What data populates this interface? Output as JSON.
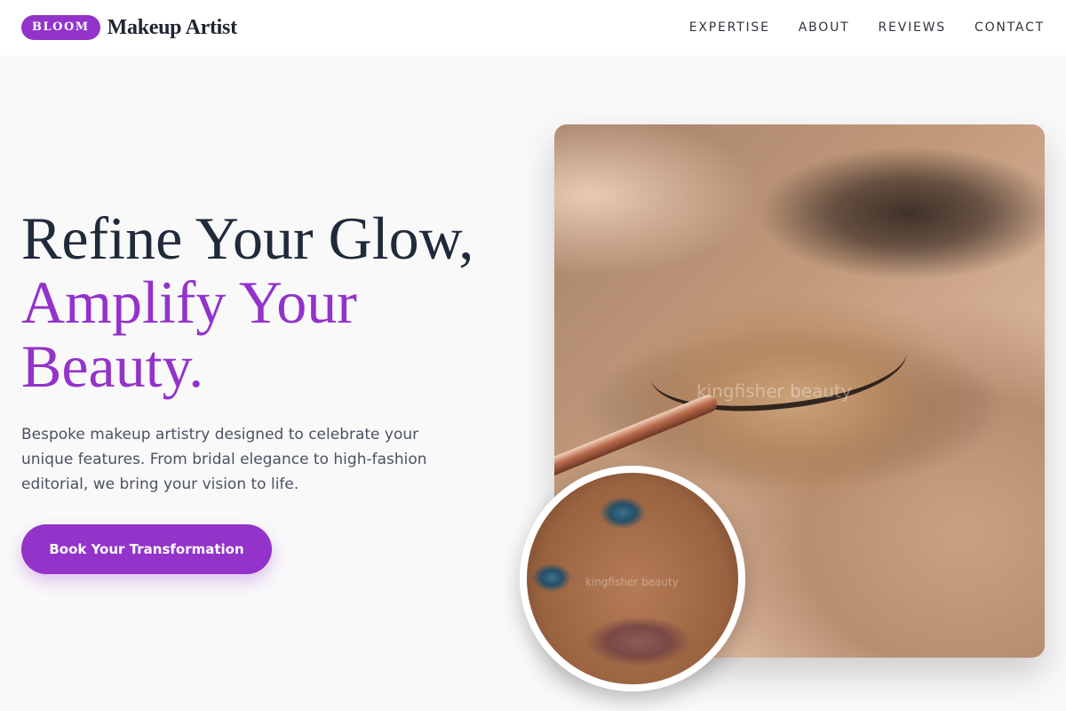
{
  "header": {
    "badge": "BLOOM",
    "brand_name": "Makeup Artist",
    "nav": [
      {
        "label": "EXPERTISE"
      },
      {
        "label": "ABOUT"
      },
      {
        "label": "REVIEWS"
      },
      {
        "label": "CONTACT"
      }
    ]
  },
  "hero": {
    "title_line1": "Refine Your Glow,",
    "title_line2": "Amplify Your",
    "title_line3": "Beauty.",
    "description": "Bespoke makeup artistry designed to celebrate your unique features. From bridal elegance to high-fashion editorial, we bring your vision to life.",
    "cta_label": "Book Your Transformation"
  },
  "images": {
    "main_watermark": "kingfisher beauty",
    "inset_watermark": "kingfisher beauty"
  },
  "colors": {
    "accent": "#9333c9",
    "title_dark": "#202a3b",
    "background": "#f9f9fa"
  }
}
